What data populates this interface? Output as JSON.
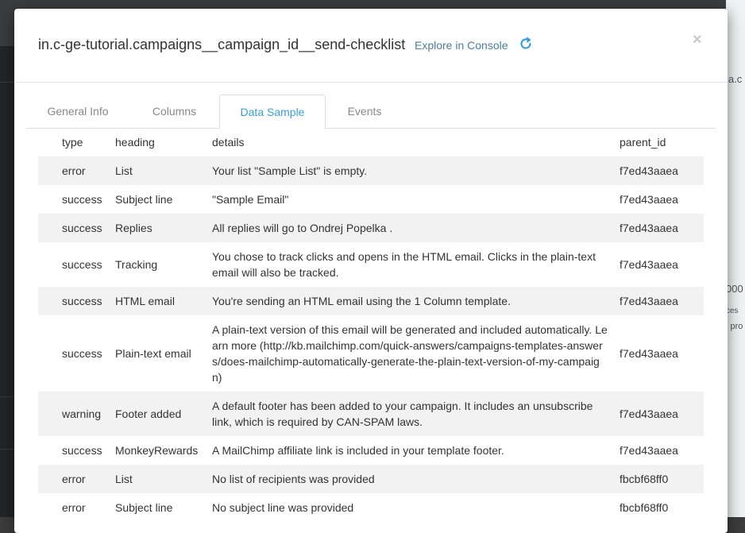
{
  "modal": {
    "title": "in.c-ge-tutorial.campaigns__campaign_id__send-checklist",
    "explore_label": "Explore in Console",
    "close_label": "×"
  },
  "tabs": [
    {
      "label": "General Info",
      "active": false
    },
    {
      "label": "Columns",
      "active": false
    },
    {
      "label": "Data Sample",
      "active": true
    },
    {
      "label": "Events",
      "active": false
    }
  ],
  "table": {
    "columns": [
      "type",
      "heading",
      "details",
      "parent_id"
    ],
    "rows": [
      {
        "type": "error",
        "heading": "List",
        "details": "Your list \"Sample List\" is empty.",
        "parent_id": "f7ed43aaea"
      },
      {
        "type": "success",
        "heading": "Subject line",
        "details": "\"Sample Email\"",
        "parent_id": "f7ed43aaea"
      },
      {
        "type": "success",
        "heading": "Replies",
        "details": "All replies will go to Ondrej Popelka .",
        "parent_id": "f7ed43aaea"
      },
      {
        "type": "success",
        "heading": "Tracking",
        "details": "You chose to track clicks and opens in the HTML email. Clicks in the plain-text email will also be tracked.",
        "parent_id": "f7ed43aaea"
      },
      {
        "type": "success",
        "heading": "HTML email",
        "details": "You're sending an HTML email using the 1 Column template.",
        "parent_id": "f7ed43aaea"
      },
      {
        "type": "success",
        "heading": "Plain-text email",
        "details": "A plain-text version of this email will be generated and included automatically. Learn more (http://kb.mailchimp.com/quick-answers/campaigns-templates-answers/does-mailchimp-automatically-generate-the-plain-text-version-of-my-campaign)",
        "parent_id": "f7ed43aaea"
      },
      {
        "type": "warning",
        "heading": "Footer added",
        "details": "A default footer has been added to your campaign. It includes an unsubscribe link, which is required by CAN-SPAM laws.",
        "parent_id": "f7ed43aaea"
      },
      {
        "type": "success",
        "heading": "MonkeyRewards",
        "details": "A MailChimp affiliate link is included in your template footer.",
        "parent_id": "f7ed43aaea"
      },
      {
        "type": "error",
        "heading": "List",
        "details": "No list of recipients was provided",
        "parent_id": "fbcbf68ff0"
      },
      {
        "type": "error",
        "heading": "Subject line",
        "details": "No subject line was provided",
        "parent_id": "fbcbf68ff0"
      }
    ]
  },
  "background": {
    "right_text_1": "la.c",
    "right_text_2": "000",
    "right_text_3": "ces",
    "right_text_4": "l pro"
  },
  "colors": {
    "accent": "#3aa0d8",
    "link": "#4a7ea0",
    "stripe": "#f2f2f2"
  }
}
